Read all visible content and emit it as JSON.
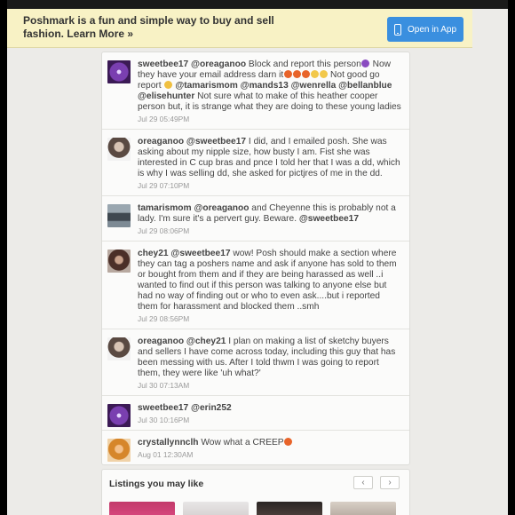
{
  "banner": {
    "message": "Poshmark is a fun and simple way to buy and sell fashion.",
    "learn_more": "Learn More »",
    "open_app_label": "Open in App"
  },
  "comments": [
    {
      "user": "sweetbee17",
      "mention": "@oreaganoo",
      "text": "Block and report this person",
      "text2": " Now they have your email address darn it",
      "text3": " Not good go report",
      "mentions_tail": "@tamarismom @mands13 @wenrella @bellanblue @elisehunter",
      "text4": " Not sure what to make of this heather cooper person but, it is strange what they are doing to these young ladies",
      "time": "Jul 29 05:49PM"
    },
    {
      "user": "oreaganoo",
      "mention": "@sweetbee17",
      "text": "I did, and I emailed posh. She was asking about my nipple size, how busty I am. Fist she was interested in C cup bras and pnce I told her that I was a dd, which is why I was selling dd, she asked for pictjres of me in the dd.",
      "time": "Jul 29 07:10PM"
    },
    {
      "user": "tamarismom",
      "mention": "@oreaganoo",
      "text": "and Cheyenne this is probably not a lady. I'm sure it's a pervert guy. Beware.",
      "mention_end": "@sweetbee17",
      "time": "Jul 29 08:06PM"
    },
    {
      "user": "chey21",
      "mention": "@sweetbee17",
      "text": "wow! Posh should make a section where they can tag a poshers name and ask if anyone has sold to them or bought from them and if they are being harassed as well ..i wanted to find out if this person was talking to anyone else but had no way of finding out or who to even ask....but i reported them for harassment and blocked them ..smh",
      "time": "Jul 29 08:56PM"
    },
    {
      "user": "oreaganoo",
      "mention": "@chey21",
      "text": "I plan on making a list of sketchy buyers and sellers I have come across today, including this guy that has been messing with us. After I told thwm I was going to report them, they were like 'uh what?'",
      "time": "Jul 30 07:13AM"
    },
    {
      "user": "sweetbee17",
      "mention": "@erin252",
      "text": "",
      "time": "Jul 30 10:16PM"
    },
    {
      "user": "crystallynnclh",
      "mention": "",
      "text": "Wow what a CREEP",
      "time": "Aug 01 12:30AM"
    }
  ],
  "listings": {
    "title": "Listings you may like",
    "prev": "‹",
    "next": "›"
  }
}
